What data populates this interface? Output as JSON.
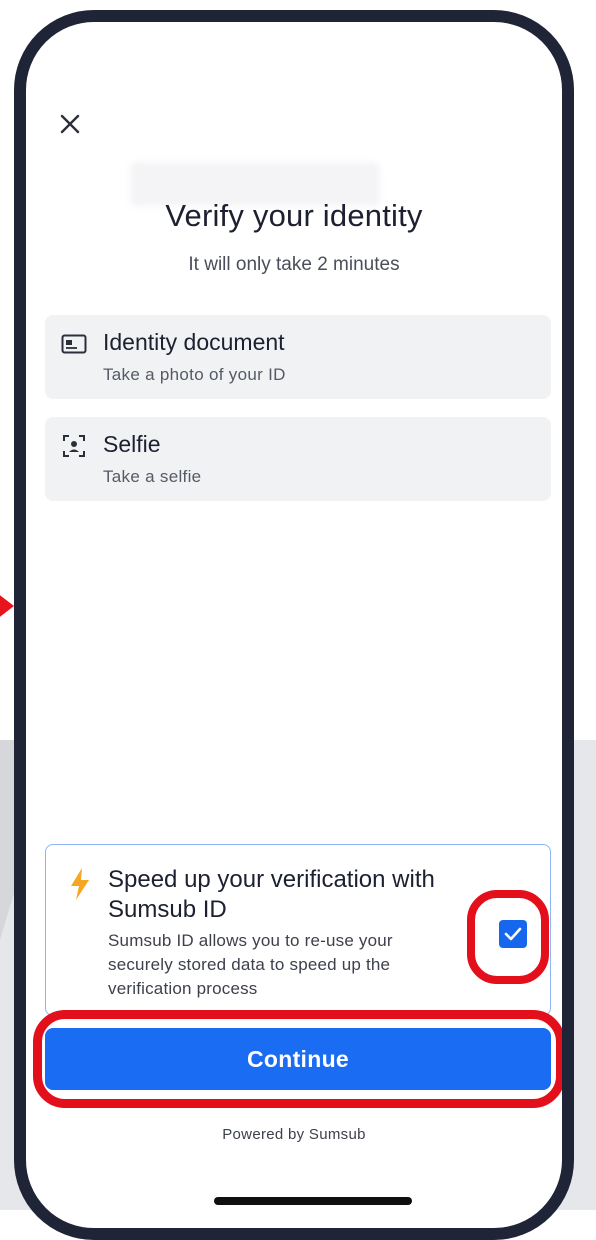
{
  "header": {
    "close_icon": "close-icon",
    "title": "Verify your identity",
    "subtitle": "It will only take 2 minutes"
  },
  "steps": [
    {
      "icon": "id-card-icon",
      "title": "Identity document",
      "subtitle": "Take a photo of your ID"
    },
    {
      "icon": "face-scan-icon",
      "title": "Selfie",
      "subtitle": "Take a selfie"
    }
  ],
  "promo": {
    "icon": "lightning-icon",
    "title": "Speed up your verification with Sumsub ID",
    "text": "Sumsub ID allows you to re-use your securely stored data to speed up the verification process",
    "checkbox_checked": true
  },
  "actions": {
    "continue_label": "Continue"
  },
  "footer": {
    "powered_by": "Powered by Sumsub"
  },
  "colors": {
    "primary": "#1a6cf2",
    "highlight": "#e3101c",
    "bolt": "#f5a623",
    "card_bg": "#f1f2f4"
  }
}
